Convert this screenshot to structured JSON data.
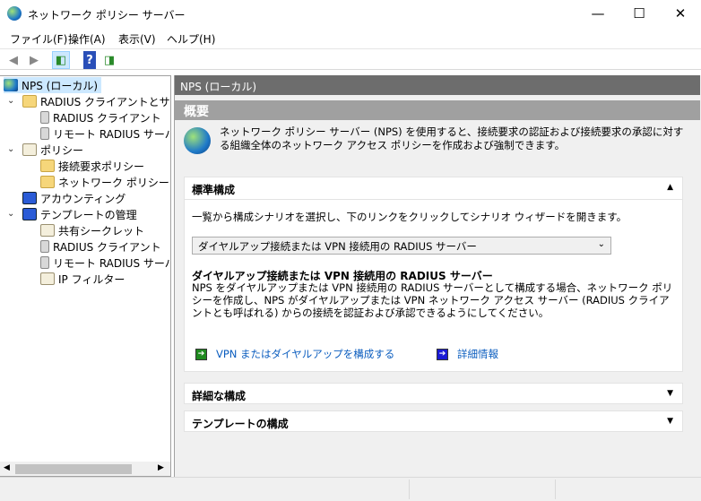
{
  "window": {
    "title": "ネットワーク ポリシー サーバー",
    "minimize": "—",
    "maximize": "☐",
    "close": "✕"
  },
  "menu": [
    "ファイル(F)",
    "操作(A)",
    "表示(V)",
    "ヘルプ(H)"
  ],
  "tree": [
    {
      "label": "NPS (ローカル)"
    },
    {
      "label": "RADIUS クライアントとサーバー"
    },
    {
      "label": "RADIUS クライアント"
    },
    {
      "label": "リモート RADIUS サーバー グループ"
    },
    {
      "label": "ポリシー"
    },
    {
      "label": "接続要求ポリシー"
    },
    {
      "label": "ネットワーク ポリシー"
    },
    {
      "label": "アカウンティング"
    },
    {
      "label": "テンプレートの管理"
    },
    {
      "label": "共有シークレット"
    },
    {
      "label": "RADIUS クライアント"
    },
    {
      "label": "リモート RADIUS サーバー"
    },
    {
      "label": "IP フィルター"
    }
  ],
  "main": {
    "header": "NPS (ローカル)",
    "overview_title": "概要",
    "overview_text": "ネットワーク ポリシー サーバー (NPS) を使用すると、接続要求の認証および接続要求の承認に対する組織全体のネットワーク アクセス ポリシーを作成および強制できます。",
    "standard": {
      "title": "標準構成",
      "instruction": "一覧から構成シナリオを選択し、下のリンクをクリックしてシナリオ ウィザードを開きます。",
      "selected": "ダイヤルアップ接続または VPN 接続用の RADIUS サーバー",
      "scenario_title": "ダイヤルアップ接続または VPN 接続用の RADIUS サーバー",
      "scenario_text": "NPS をダイヤルアップまたは VPN 接続用の RADIUS サーバーとして構成する場合、ネットワーク ポリシーを作成し、NPS がダイヤルアップまたは VPN ネットワーク アクセス サーバー (RADIUS クライアントとも呼ばれる) からの接続を認証および承認できるようにしてください。",
      "link_configure": "VPN またはダイヤルアップを構成する",
      "link_more": "詳細情報"
    },
    "advanced": "詳細な構成",
    "templates": "テンプレートの構成"
  }
}
